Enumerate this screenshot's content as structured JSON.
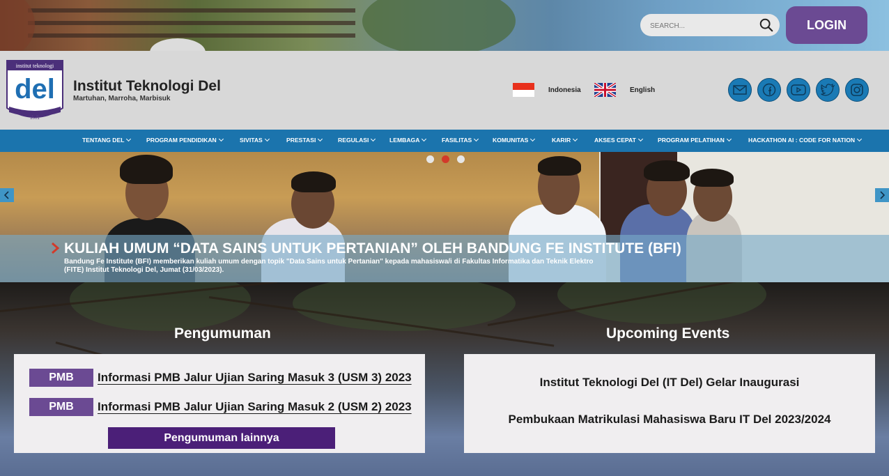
{
  "search": {
    "placeholder": "SEARCH..."
  },
  "login_label": "LOGIN",
  "header": {
    "site_name": "Institut Teknologi Del",
    "tagline": "Martuhan, Marroha, Marbisuk",
    "logo_text": "del",
    "logo_top": "institut teknologi",
    "logo_year": "2001"
  },
  "languages": [
    {
      "label": "Indonesia",
      "icon": "indonesia-flag-icon"
    },
    {
      "label": "English",
      "icon": "uk-flag-icon"
    }
  ],
  "social_icons": [
    "email-icon",
    "facebook-icon",
    "youtube-icon",
    "twitter-icon",
    "instagram-icon"
  ],
  "nav": [
    "TENTANG DEL",
    "PROGRAM PENDIDIKAN",
    "SIVITAS",
    "PRESTASI",
    "REGULASI",
    "LEMBAGA",
    "FASILITAS",
    "KOMUNITAS",
    "KARIR",
    "AKSES CEPAT",
    "PROGRAM PELATIHAN",
    "HACKATHON AI : CODE FOR NATION"
  ],
  "slider": {
    "active_index": 1,
    "dot_count": 3,
    "title": "KULIAH UMUM “DATA SAINS UNTUK PERTANIAN” OLEH BANDUNG FE INSTITUTE (BFI)",
    "description": "Bandung Fe Institute (BFI) memberikan kuliah umum dengan topik \"Data Sains untuk Pertanian\" kepada mahasiswa/i di Fakultas Informatika dan Teknik Elektro (FITE) Institut Teknologi Del, Jumat (31/03/2023)."
  },
  "announcements": {
    "heading": "Pengumuman",
    "items": [
      {
        "badge": "PMB",
        "title": "Informasi PMB Jalur Ujian Saring Masuk 3 (USM 3) 2023"
      },
      {
        "badge": "PMB",
        "title": "Informasi PMB Jalur Ujian Saring Masuk 2 (USM 2) 2023"
      }
    ],
    "more_label": "Pengumuman lainnya"
  },
  "events": {
    "heading": "Upcoming Events",
    "items": [
      "Institut Teknologi Del (IT Del) Gelar Inaugurasi",
      "Pembukaan Matrikulasi Mahasiswa Baru IT Del 2023/2024"
    ]
  },
  "colors": {
    "nav": "#1b74ad",
    "login": "#6b4a93",
    "badge": "#6b4a93",
    "more_button": "#4b1f78",
    "social": "#1a7ab5"
  }
}
